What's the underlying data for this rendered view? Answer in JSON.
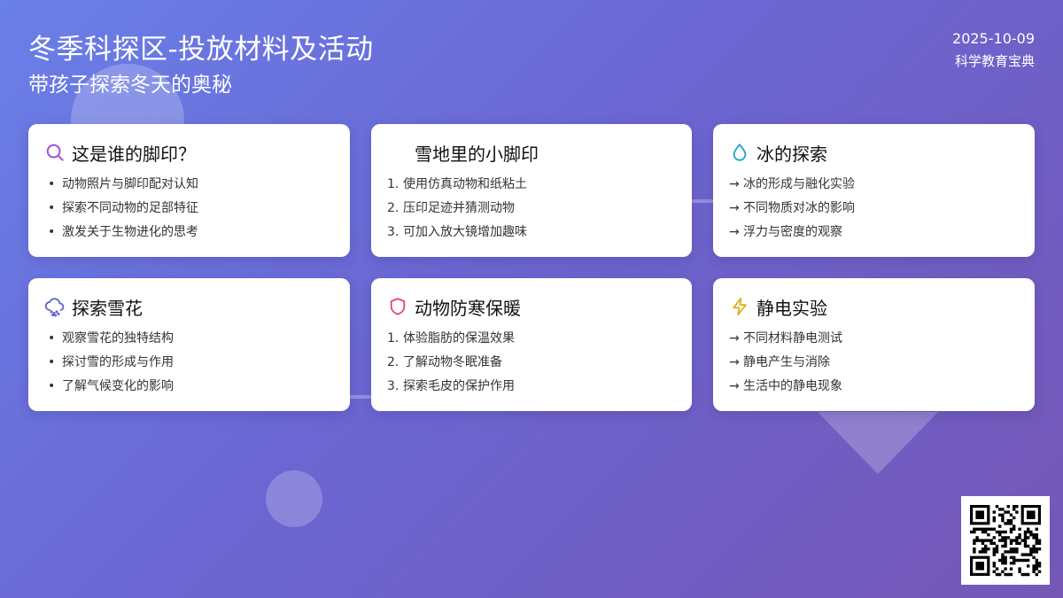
{
  "header": {
    "title": "冬季科探区-投放材料及活动",
    "subtitle": "带孩子探索冬天的奥秘",
    "date": "2025-10-09",
    "brand": "科学教育宝典"
  },
  "colors": {
    "bg_start": "#6a7fe8",
    "bg_end": "#7557b6",
    "search_icon": "#a052d6",
    "drop_icon": "#1ba6c8",
    "snow_icon": "#5b5fd0",
    "shield_icon": "#e0457b",
    "bolt_icon": "#e0b020"
  },
  "cards": [
    {
      "title": "这是谁的脚印？",
      "icon": "search-icon",
      "list_style": "bullet",
      "items": [
        "动物照片与脚印配对认知",
        "探索不同动物的足部特征",
        "激发关于生物进化的思考"
      ]
    },
    {
      "title": "雪地里的小脚印",
      "icon": "",
      "list_style": "number",
      "markers": [
        "1.",
        "2.",
        "3."
      ],
      "items": [
        "使用仿真动物和纸粘土",
        "压印足迹并猜测动物",
        "可加入放大镜增加趣味"
      ]
    },
    {
      "title": "冰的探索",
      "icon": "water-drop-icon",
      "list_style": "arrow",
      "markers": [
        "→",
        "→",
        "→"
      ],
      "items": [
        "冰的形成与融化实验",
        "不同物质对冰的影响",
        "浮力与密度的观察"
      ]
    },
    {
      "title": "探索雪花",
      "icon": "snow-cloud-icon",
      "list_style": "bullet",
      "items": [
        "观察雪花的独特结构",
        "探讨雪的形成与作用",
        "了解气候变化的影响"
      ]
    },
    {
      "title": "动物防寒保暖",
      "icon": "shield-icon",
      "list_style": "number",
      "markers": [
        "1.",
        "2.",
        "3."
      ],
      "items": [
        "体验脂肪的保温效果",
        "了解动物冬眠准备",
        "探索毛皮的保护作用"
      ]
    },
    {
      "title": "静电实验",
      "icon": "lightning-icon",
      "list_style": "arrow",
      "markers": [
        "→",
        "→",
        "→"
      ],
      "items": [
        "不同材料静电测试",
        "静电产生与消除",
        "生活中的静电现象"
      ]
    }
  ]
}
